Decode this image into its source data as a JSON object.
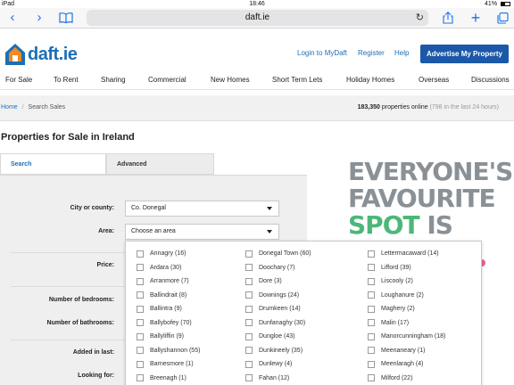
{
  "status_bar": {
    "carrier": "iPad",
    "time": "18:46",
    "battery": "41%"
  },
  "browser": {
    "url": "daft.ie"
  },
  "header": {
    "logo_text": "daft",
    "logo_tld": ".ie",
    "login": "Login to MyDaft",
    "register": "Register",
    "help": "Help",
    "advertise": "Advertise My Property"
  },
  "nav": [
    "For Sale",
    "To Rent",
    "Sharing",
    "Commercial",
    "New Homes",
    "Short Term Lets",
    "Holiday Homes",
    "Overseas",
    "Discussions"
  ],
  "breadcrumb": {
    "home": "Home",
    "sep": "/",
    "current": "Search Sales"
  },
  "online": {
    "count": "183,350",
    "label": "properties online",
    "recent": "(798 in the last 24 hours)"
  },
  "page_title": "Properties for Sale in Ireland",
  "tabs": {
    "search": "Search",
    "advanced": "Advanced"
  },
  "form": {
    "city_label": "City or county:",
    "city_value": "Co. Donegal",
    "area_label": "Area:",
    "area_value": "Choose an area",
    "price_label": "Price:",
    "bedrooms_label": "Number of bedrooms:",
    "bathrooms_label": "Number of bathrooms:",
    "added_label": "Added in last:",
    "looking_label": "Looking for:"
  },
  "advert": {
    "line1": "EVERYONE'S",
    "line2": "FAVOURITE",
    "line3_green": "SPOT",
    "line3_rest": " IS"
  },
  "areas": {
    "col1": [
      "Annagry (16)",
      "Ardara (30)",
      "Arranmore (7)",
      "Ballindrait (8)",
      "Ballintra (9)",
      "Ballybofey (70)",
      "Ballyliffin (9)",
      "Ballyshannon (55)",
      "Barnesmore (1)",
      "Breenagh (1)"
    ],
    "col2": [
      "Donegal Town (60)",
      "Doochary (7)",
      "Dore (3)",
      "Downings (24)",
      "Drumkeen (14)",
      "Dunfanaghy (30)",
      "Dungloe (43)",
      "Dunkineely (35)",
      "Dunlewy (4)",
      "Fahan (12)"
    ],
    "col3": [
      "Lettermacaward (14)",
      "Lifford (39)",
      "Liscooly (2)",
      "Loughanure (2)",
      "Maghery (2)",
      "Malin (17)",
      "Manorcunningham (18)",
      "Meenaneary (1)",
      "Meenlaragh (4)",
      "Milford (22)"
    ]
  }
}
